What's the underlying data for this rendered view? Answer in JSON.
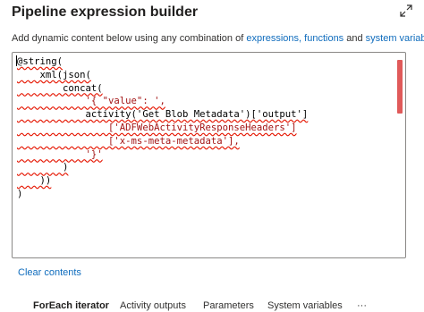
{
  "header": {
    "title": "Pipeline expression builder",
    "expand_icon": "expand-diagonal-icon"
  },
  "description": {
    "prefix": "Add dynamic content below using any combination of ",
    "link_expressions": "expressions,",
    "link_functions": "functions",
    "and_text": " and ",
    "link_system_variables": "system variables."
  },
  "editor": {
    "lines": [
      "@string(",
      "    xml(json(",
      "        concat(",
      "            '{ \"value\": ',",
      "            activity('Get Blob Metadata')['output']",
      "                ['ADFWebActivityResponseHeaders']",
      "                ['x-ms-meta-metadata'],",
      "            '}'",
      "        )",
      "    ))",
      ")"
    ],
    "colors": {
      "string": "#a31515",
      "squiggle": "#e51400",
      "scrollbar": "#e05a5a"
    }
  },
  "actions": {
    "clear_contents": "Clear contents"
  },
  "tabs": [
    {
      "label": "ForEach iterator",
      "active": true
    },
    {
      "label": "Activity outputs",
      "active": false
    },
    {
      "label": "Parameters",
      "active": false
    },
    {
      "label": "System variables",
      "active": false
    },
    {
      "label": "···",
      "active": false
    }
  ]
}
